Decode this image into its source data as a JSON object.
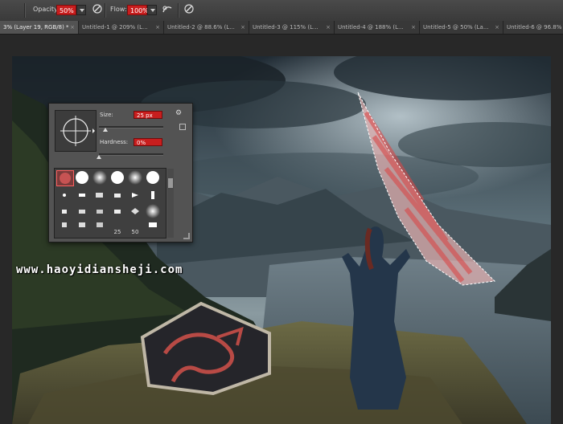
{
  "options_bar": {
    "opacity_label": "Opacity:",
    "opacity_value": "50%",
    "flow_label": "Flow:",
    "flow_value": "100%"
  },
  "tabs": [
    {
      "label": "3% (Layer 19, RGB/8) *",
      "active": true
    },
    {
      "label": "Untitled-1 @ 209% (L...",
      "active": false
    },
    {
      "label": "Untitled-2 @ 88.6% (L...",
      "active": false
    },
    {
      "label": "Untitled-3 @ 115% (L...",
      "active": false
    },
    {
      "label": "Untitled-4 @ 188% (L...",
      "active": false
    },
    {
      "label": "Untitled-5 @ 50% (La...",
      "active": false
    },
    {
      "label": "Untitled-6 @ 96.8%",
      "active": false
    }
  ],
  "brush_picker": {
    "size_label": "Size:",
    "size_value": "25 px",
    "hardness_label": "Hardness:",
    "hardness_value": "0%",
    "size_level": 0.1,
    "hardness_level": 0.0,
    "preset_numbers": [
      "25",
      "50"
    ]
  },
  "watermark": "www.haoyidiansheji.com",
  "colors": {
    "accent_red": "#c81e1e",
    "panel_gray": "#535353",
    "tab_active": "#535353",
    "brush_stroke": "#e06a6a"
  },
  "icons": [
    "airbrush-icon",
    "pressure-opacity-icon",
    "pressure-size-icon",
    "gear-icon",
    "new-preset-icon",
    "close-icon"
  ]
}
